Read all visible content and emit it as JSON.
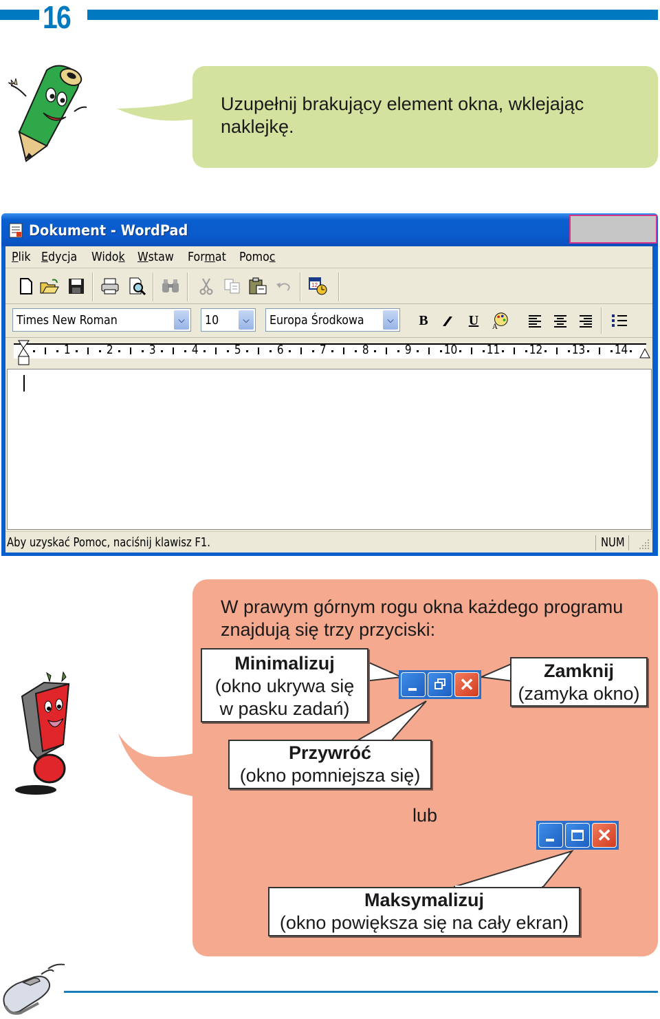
{
  "header": {
    "page_number": "16",
    "accent_color": "#0079c1"
  },
  "instruction": {
    "text": "Uzupełnij brakujący element okna, wklejając naklejkę.",
    "bubble_color": "#d3e29e"
  },
  "wordpad": {
    "title": "Dokument - WordPad",
    "missing_slot_color": "#c6c6c6",
    "missing_slot_border": "#d8318a",
    "menu": [
      {
        "label": "Plik",
        "accel": "P"
      },
      {
        "label": "Edycja",
        "accel": "E"
      },
      {
        "label": "Widok",
        "accel": "k"
      },
      {
        "label": "Wstaw",
        "accel": "W"
      },
      {
        "label": "Format",
        "accel": "m"
      },
      {
        "label": "Pomoc",
        "accel": "c"
      }
    ],
    "toolbar": [
      "new-icon",
      "open-icon",
      "save-icon",
      "print-icon",
      "print-preview-icon",
      "find-icon",
      "cut-icon",
      "copy-icon",
      "paste-icon",
      "undo-icon",
      "date-time-icon"
    ],
    "format_bar": {
      "font": "Times New Roman",
      "size": "10",
      "script": "Europa Środkowa",
      "bold": "B",
      "italic": "I",
      "underline": "U"
    },
    "ruler": [
      "1",
      "2",
      "3",
      "4",
      "5",
      "6",
      "7",
      "8",
      "9",
      "10",
      "11",
      "12",
      "13",
      "14"
    ],
    "status": {
      "text": "Aby uzyskać Pomoc, naciśnij klawisz F1.",
      "num": "NUM"
    }
  },
  "info": {
    "text": "W prawym górnym rogu okna każdego programu znajdują się trzy przyciski:",
    "bubble_color": "#f5a98e",
    "minimize": {
      "title": "Minimalizuj",
      "line1": "(okno ukrywa się",
      "line2": "w pasku zadań)"
    },
    "close": {
      "title": "Zamknij",
      "desc": "(zamyka okno)"
    },
    "restore": {
      "title": "Przywróć",
      "desc": "(okno pomniejsza się)"
    },
    "or": "lub",
    "maximize": {
      "title": "Maksymalizuj",
      "desc": "(okno powiększa się na cały ekran)"
    }
  }
}
